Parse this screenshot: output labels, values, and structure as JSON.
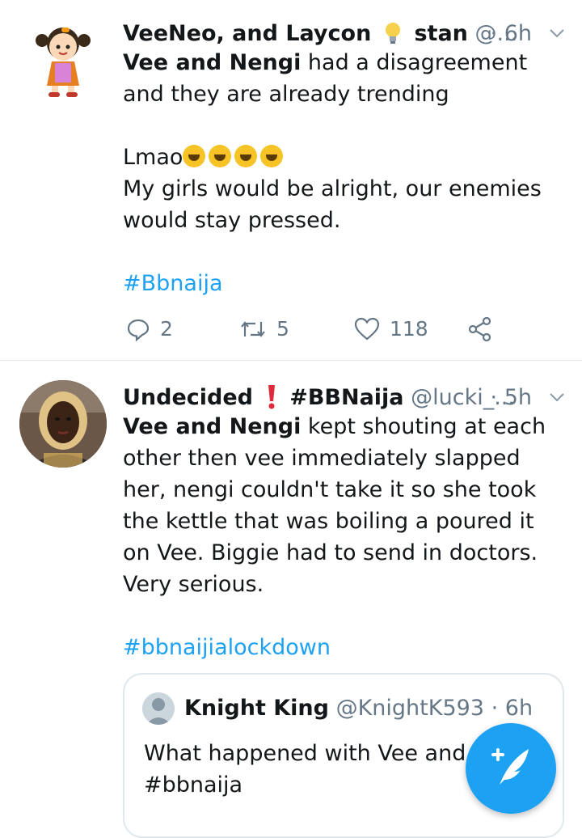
{
  "tweets": [
    {
      "author_name": "VeeNeo, and Laycon",
      "author_name_suffix": "stan",
      "handle": "@...",
      "time": "6h",
      "bold_lead": "Vee and Nengi",
      "text_rest": " had a disagreement and they are already trending\n\nLmao",
      "text_after_emoji": "My girls would be alright, our enemies would stay pressed.",
      "hashtag": "#Bbnaija",
      "replies": "2",
      "retweets": "5",
      "likes": "118"
    },
    {
      "author_name": "Undecided",
      "author_name_suffix": "#BBNaija",
      "handle": "@lucki_...",
      "time": "5h",
      "bold_lead": "Vee and Nengi",
      "text_rest": " kept shouting at each other then vee immediately slapped her, nengi couldn't take it so she took the kettle that was boiling a poured it on Vee. Biggie had to send in doctors. Very serious.",
      "hashtag": "#bbnaijialockdown",
      "quoted": {
        "author_name": "Knight King",
        "handle": "@KnightK593",
        "time": "6h",
        "text": "What happened with Vee and N\n#bbnaija"
      }
    }
  ],
  "icons": {
    "reply": "reply-icon",
    "retweet": "retweet-icon",
    "like": "heart-icon",
    "share": "share-icon",
    "more": "chevron-down-icon",
    "compose": "compose-tweet-icon"
  },
  "colors": {
    "accent": "#1da1f2",
    "secondary_text": "#657786",
    "divider": "#e1e8ed"
  }
}
